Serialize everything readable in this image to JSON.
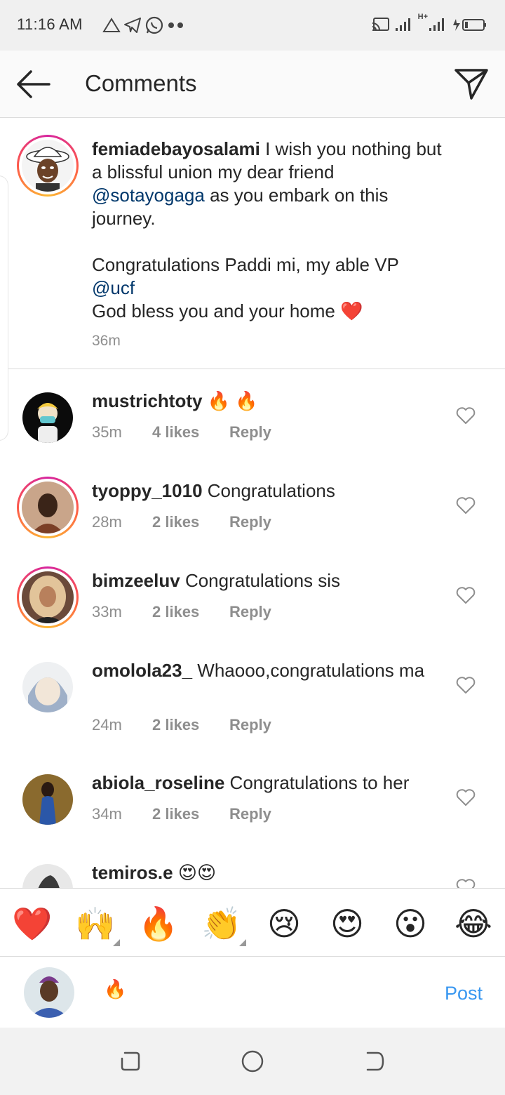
{
  "status_bar": {
    "time": "11:16 AM",
    "network_label": "H+"
  },
  "header": {
    "title": "Comments"
  },
  "caption": {
    "username": "femiadebayosalami",
    "text_1": " I wish you nothing but a blissful union my dear friend ",
    "mention_1": "@sotayogaga",
    "text_2": " as you embark on this journey.",
    "text_3": "Congratulations Paddi mi, my able VP ",
    "mention_2": "@ucf",
    "text_4": "God bless you and your home ",
    "heart_emoji": "❤️",
    "time": "36m"
  },
  "comments": [
    {
      "username": "mustrichtoty",
      "text": " 🔥 🔥",
      "time": "35m",
      "likes": "4 likes",
      "reply": "Reply"
    },
    {
      "username": "tyoppy_1010",
      "text": " Congratulations",
      "time": "28m",
      "likes": "2 likes",
      "reply": "Reply"
    },
    {
      "username": "bimzeeluv",
      "text": " Congratulations sis",
      "time": "33m",
      "likes": "2 likes",
      "reply": "Reply"
    },
    {
      "username": "omolola23_",
      "text": " Whaooo,congratulations ma",
      "time": "24m",
      "likes": "2 likes",
      "reply": "Reply"
    },
    {
      "username": "abiola_roseline",
      "text": " Congratulations to her",
      "time": "34m",
      "likes": "2 likes",
      "reply": "Reply"
    },
    {
      "username": "temiros.e",
      "text": " 😍😍"
    }
  ],
  "emoji_bar": [
    "❤️",
    "🙌",
    "🔥",
    "👏",
    "😢",
    "😍",
    "😮",
    "😂"
  ],
  "compose": {
    "input_value": "🔥",
    "post_label": "Post"
  },
  "colors": {
    "accent": "#3897f0",
    "mention": "#00376b",
    "secondary_text": "#8e8e8e"
  }
}
